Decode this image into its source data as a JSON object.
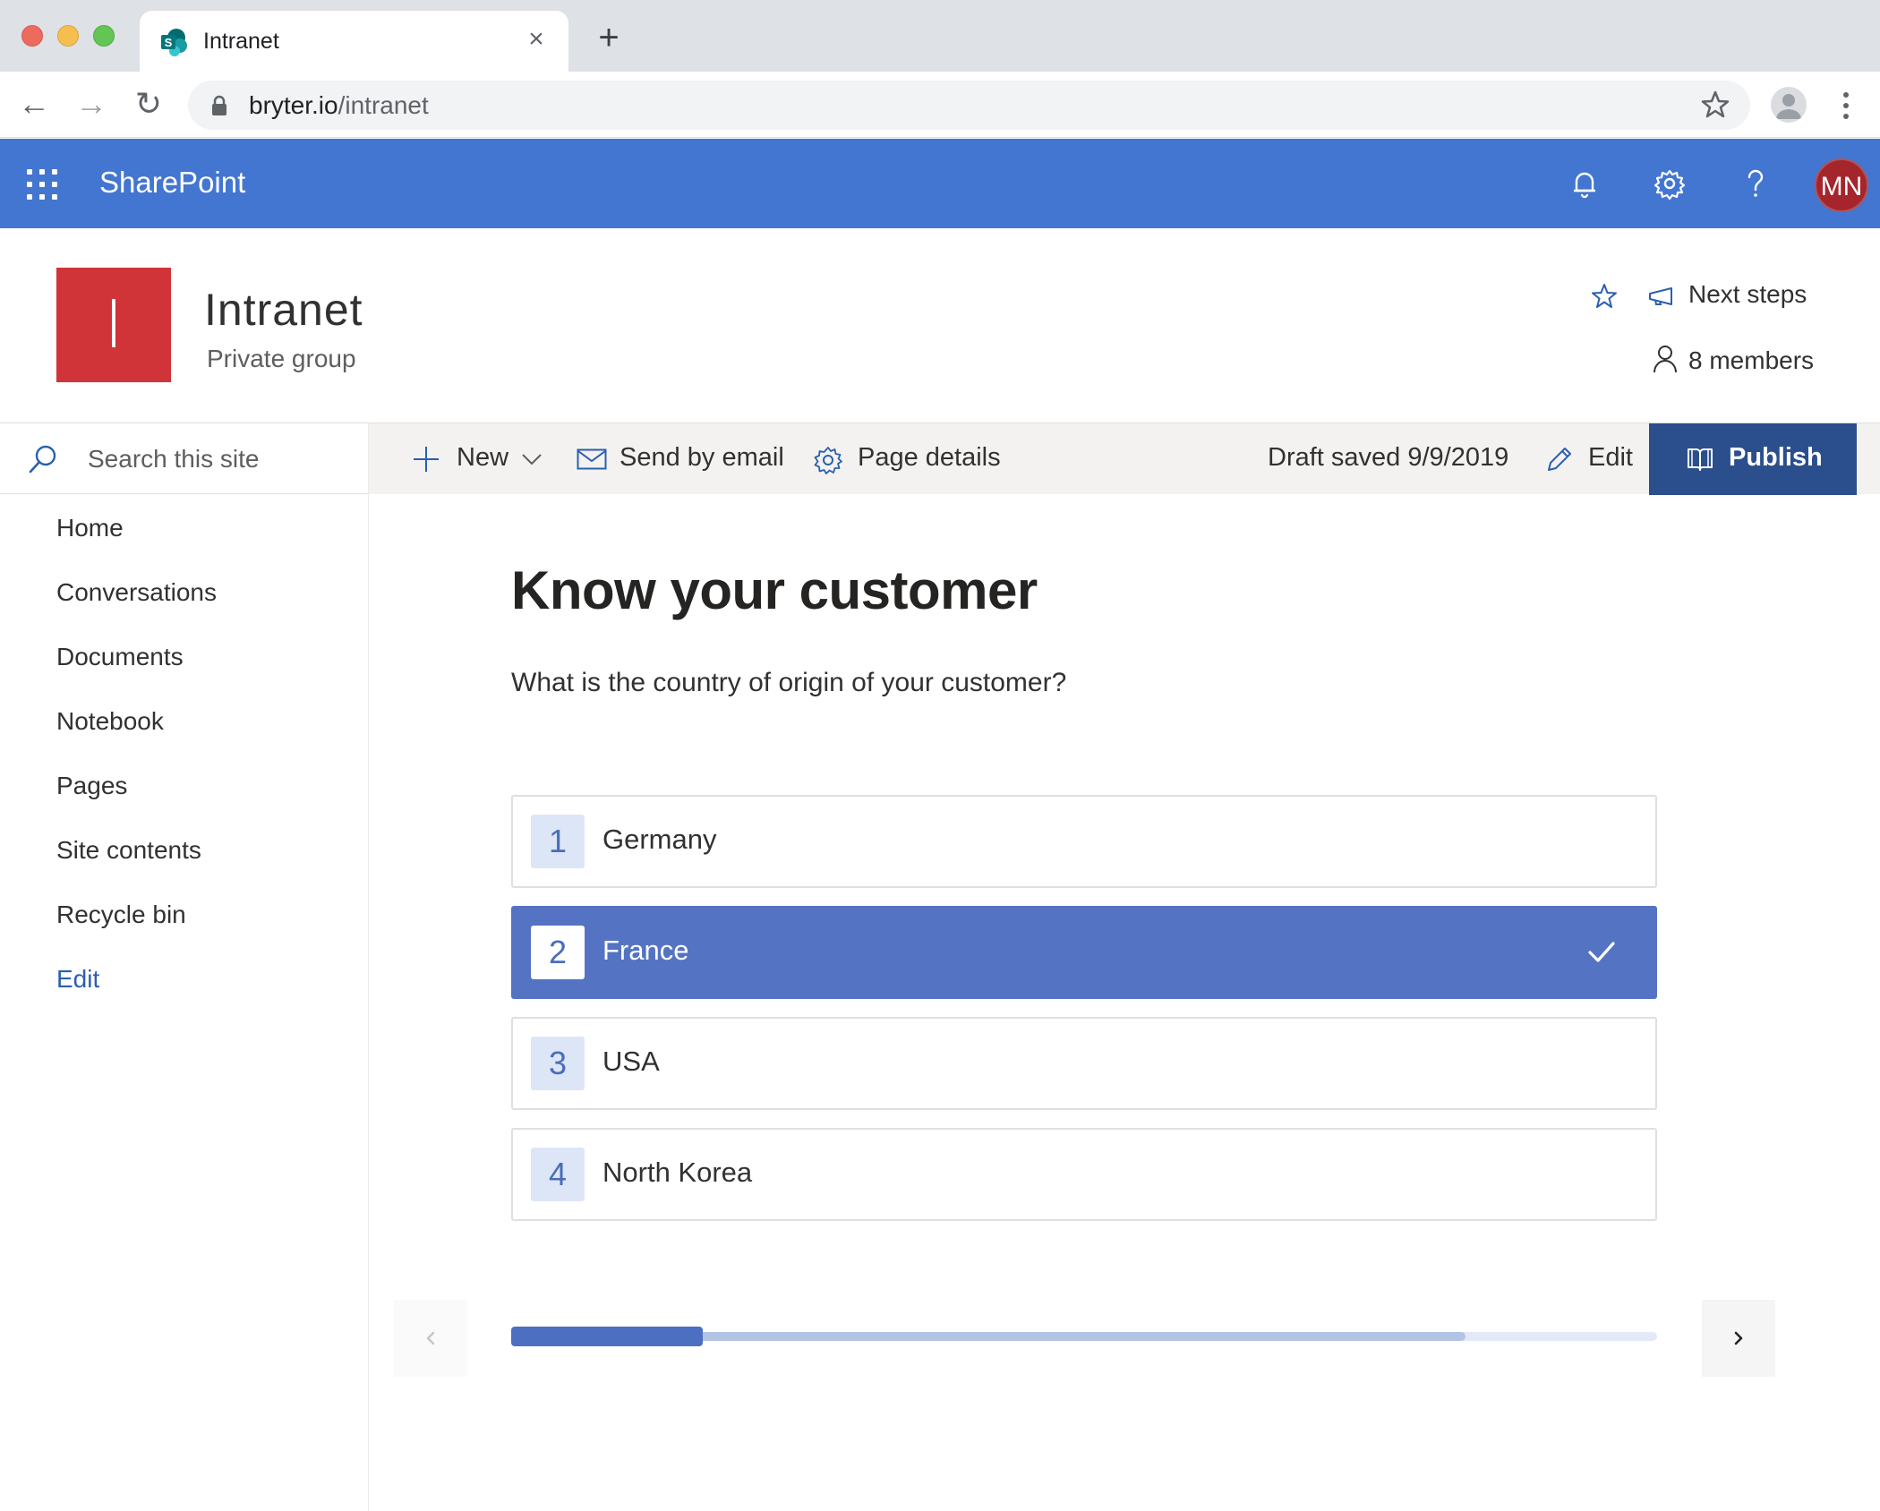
{
  "browser": {
    "tab_title": "Intranet",
    "tab_close": "×",
    "new_tab": "+",
    "url_domain": "bryter.io",
    "url_path": "/intranet",
    "back": "←",
    "forward": "→",
    "reload": "↻"
  },
  "suitebar": {
    "brand": "SharePoint",
    "avatar_initials": "MN",
    "icons": [
      "waffle-icon",
      "bell-icon",
      "gear-icon",
      "help-icon"
    ],
    "background": "#4376d1"
  },
  "site": {
    "logo_letter": "I",
    "title": "Intranet",
    "subtitle": "Private group",
    "next_steps": "Next steps",
    "members": "8 members",
    "logo_color": "#d13438"
  },
  "leftnav": {
    "search_placeholder": "Search this site",
    "items": [
      {
        "label": "Home"
      },
      {
        "label": "Conversations"
      },
      {
        "label": "Documents"
      },
      {
        "label": "Notebook"
      },
      {
        "label": "Pages"
      },
      {
        "label": "Site contents"
      },
      {
        "label": "Recycle bin"
      },
      {
        "label": "Edit"
      }
    ]
  },
  "commandbar": {
    "new_label": "New",
    "send_label": "Send by email",
    "details_label": "Page details",
    "draft_status": "Draft saved 9/9/2019",
    "edit_label": "Edit",
    "publish_label": "Publish",
    "publish_color": "#2b4f8c"
  },
  "main": {
    "title": "Know your customer",
    "question": "What is the country of origin of your customer?",
    "options": [
      {
        "number": "1",
        "label": "Germany",
        "selected": false
      },
      {
        "number": "2",
        "label": "France",
        "selected": true
      },
      {
        "number": "3",
        "label": "USA",
        "selected": false
      },
      {
        "number": "4",
        "label": "North Korea",
        "selected": false
      }
    ],
    "progress": {
      "completed_fraction": 0.167,
      "buffer_fraction": 0.833
    },
    "accent_color": "#5573c3"
  }
}
